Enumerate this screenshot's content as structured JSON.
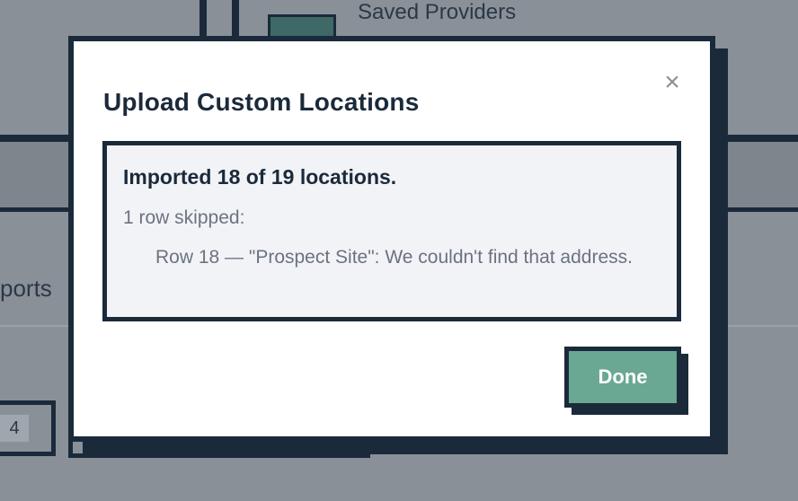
{
  "background": {
    "header_text": "Saved Providers",
    "section_text": "ports",
    "page_number": "4"
  },
  "modal": {
    "title": "Upload Custom Locations",
    "close_icon": "×",
    "result": {
      "summary": "Imported 18 of 19 locations.",
      "skipped_label": "1 row skipped:",
      "skipped_rows": [
        "Row 18 — \"Prospect Site\": We couldn't find that address."
      ]
    },
    "done_label": "Done"
  },
  "colors": {
    "overlay": "#8a9098",
    "border": "#1b2a3a",
    "accent": "#6aa894",
    "result_bg": "#f2f3f7"
  }
}
